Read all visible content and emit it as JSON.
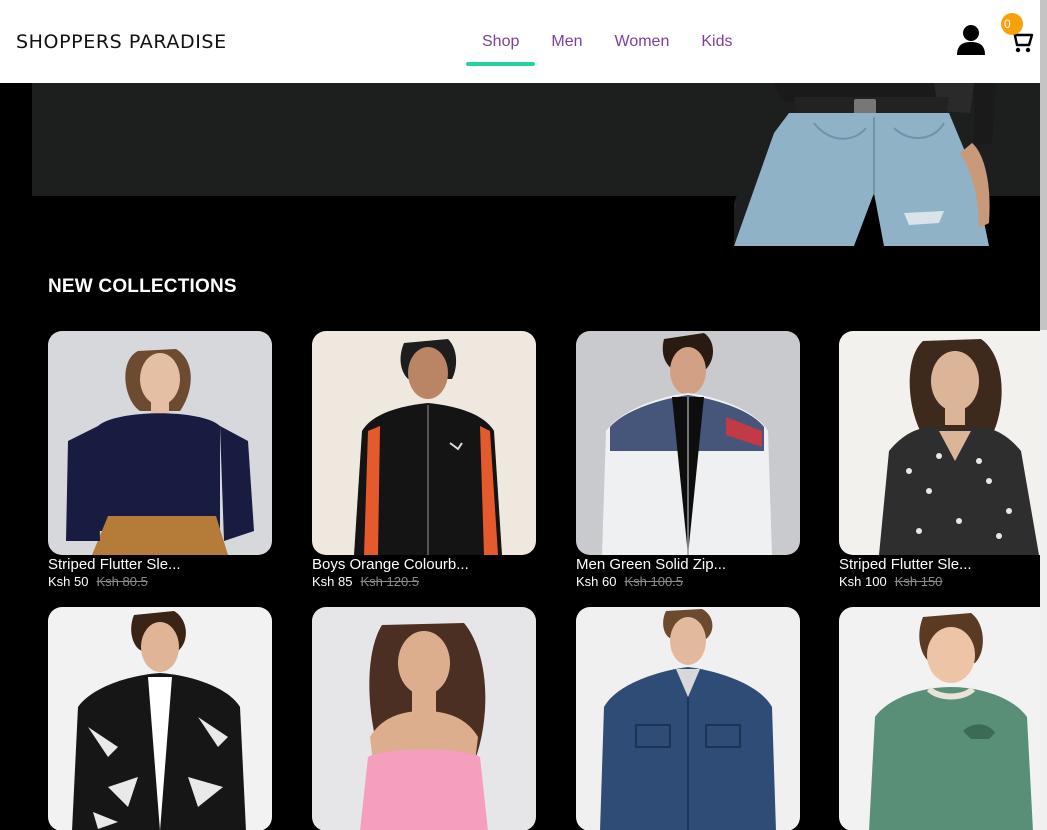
{
  "header": {
    "brand": "SHOPPERS PARADISE",
    "nav": [
      {
        "label": "Shop",
        "active": true
      },
      {
        "label": "Men",
        "active": false
      },
      {
        "label": "Women",
        "active": false
      },
      {
        "label": "Kids",
        "active": false
      }
    ],
    "cart_count": "0",
    "icons": [
      "user-icon",
      "cart-icon"
    ],
    "accent_color": "#22d3a0",
    "nav_color": "#7b3fa0",
    "badge_color": "#f7a10c"
  },
  "section": {
    "title": "NEW COLLECTIONS"
  },
  "products": [
    {
      "name": "Striped Flutter Sle...",
      "price": "Ksh 50",
      "old_price": "Ksh 80.5"
    },
    {
      "name": "Boys Orange Colourb...",
      "price": "Ksh 85",
      "old_price": "Ksh 120.5"
    },
    {
      "name": "Men Green Solid Zip...",
      "price": "Ksh 60",
      "old_price": "Ksh 100.5"
    },
    {
      "name": "Striped Flutter Sle...",
      "price": "Ksh 100",
      "old_price": "Ksh 150"
    },
    {
      "name": "",
      "price": "",
      "old_price": ""
    },
    {
      "name": "",
      "price": "",
      "old_price": ""
    },
    {
      "name": "",
      "price": "",
      "old_price": ""
    },
    {
      "name": "",
      "price": "",
      "old_price": ""
    }
  ]
}
